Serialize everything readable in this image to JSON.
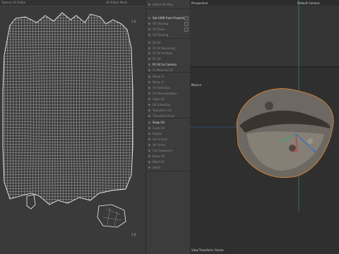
{
  "uv_editor": {
    "tab_left": "Texture UV Editor",
    "tab_right": "UV Editor Mesh",
    "tick_top": "1.0",
    "tick_bottom": "1.0"
  },
  "menu": {
    "items": [
      {
        "label": "Select UV Poly",
        "style": "dim"
      },
      {
        "label": "Set UVW from Projection",
        "style": "bright"
      },
      {
        "label": "UV Unwrap",
        "style": "dim"
      },
      {
        "label": "UV Relax",
        "style": "dim"
      },
      {
        "label": "UV Packing",
        "style": "dim"
      },
      {
        "label": "Fit UV",
        "style": "dim"
      },
      {
        "label": "Fit UV Bounding",
        "style": "dim"
      },
      {
        "label": "Fit UV to Mesh",
        "style": "dim"
      },
      {
        "label": "Fit UV",
        "style": "dim"
      },
      {
        "label": "Fit UV to Camera",
        "style": "bright"
      },
      {
        "label": "Fit Mesh to UV",
        "style": "dim"
      },
      {
        "label": "Mirror U",
        "style": "dim"
      },
      {
        "label": "Mirror V",
        "style": "dim"
      },
      {
        "label": "UV Selection",
        "style": "dim"
      },
      {
        "label": "UV Normalization",
        "style": "dim"
      },
      {
        "label": "Align UV",
        "style": "dim"
      },
      {
        "label": "UV Selection",
        "style": "dim"
      },
      {
        "label": "Transform UV",
        "style": "dim"
      },
      {
        "label": "Transform Pivot",
        "style": "dim"
      },
      {
        "label": "Snap UV",
        "style": "bright"
      },
      {
        "label": "Scale UV",
        "style": "dim"
      },
      {
        "label": "Rotate",
        "style": "dim"
      },
      {
        "label": "UV to Grid",
        "style": "dim"
      },
      {
        "label": "UV Ortho",
        "style": "dim"
      },
      {
        "label": "Flip Sequence",
        "style": "dim"
      },
      {
        "label": "Move UV",
        "style": "dim"
      },
      {
        "label": "Weld UV",
        "style": "dim"
      },
      {
        "label": "Stitch",
        "style": "dim"
      }
    ]
  },
  "viewport": {
    "top_label": "Perspective",
    "camera_label": "Default Camera",
    "mid_label": "Move",
    "bottom_label": "View Transform: Scene"
  },
  "colors": {
    "wire": "#e8e8e8",
    "axis_green": "#2fa86a",
    "axis_red": "#c23b3b",
    "axis_blue": "#3b6fd0",
    "selection_orange": "#e0892c"
  }
}
